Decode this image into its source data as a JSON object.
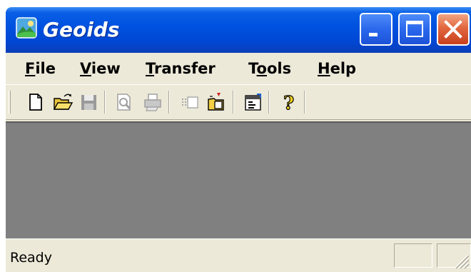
{
  "window": {
    "title": "Geoids"
  },
  "menu": {
    "items": [
      {
        "accel": "F",
        "rest": "ile"
      },
      {
        "accel": "V",
        "rest": "iew"
      },
      {
        "accel": "T",
        "rest": "ransfer"
      },
      {
        "pre": "T",
        "accel": "o",
        "rest": "ols"
      },
      {
        "accel": "H",
        "rest": "elp"
      }
    ]
  },
  "toolbar": {
    "buttons": [
      {
        "icon": "new-document-icon",
        "enabled": true
      },
      {
        "icon": "open-folder-icon",
        "enabled": true
      },
      {
        "icon": "save-disk-icon",
        "enabled": false
      },
      {
        "icon": "print-preview-icon",
        "enabled": false
      },
      {
        "icon": "print-icon",
        "enabled": false
      },
      {
        "icon": "transfer-icon",
        "enabled": false
      },
      {
        "icon": "open-transfer-folder-icon",
        "enabled": true
      },
      {
        "icon": "properties-icon",
        "enabled": true
      },
      {
        "icon": "help-icon",
        "enabled": true
      }
    ]
  },
  "status": {
    "text": "Ready"
  },
  "colors": {
    "titlebar": "#0052e0",
    "chrome": "#ece9d8",
    "client": "#808080",
    "close": "#e2673f"
  }
}
